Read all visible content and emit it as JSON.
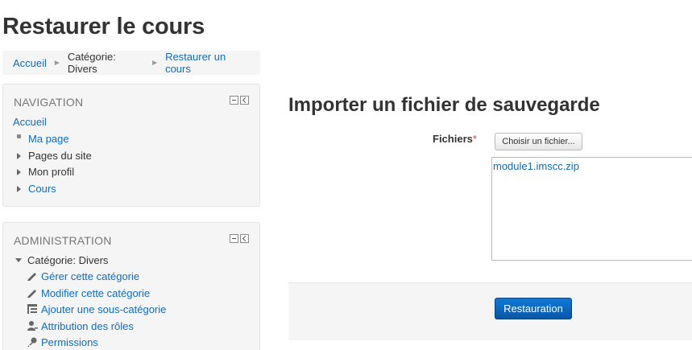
{
  "page": {
    "title": "Restaurer le cours"
  },
  "breadcrumb": {
    "items": [
      {
        "label": "Accueil"
      },
      {
        "label": "Catégorie: Divers"
      },
      {
        "label": "Restaurer un cours"
      }
    ]
  },
  "navigation": {
    "header": "NAVIGATION",
    "home": "Accueil",
    "items": [
      {
        "label": "Ma page"
      },
      {
        "label": "Pages du site"
      },
      {
        "label": "Mon profil"
      },
      {
        "label": "Cours"
      }
    ]
  },
  "administration": {
    "header": "ADMINISTRATION",
    "category": "Catégorie: Divers",
    "items": [
      {
        "label": "Gérer cette catégorie",
        "icon": "pencil-icon"
      },
      {
        "label": "Modifier cette catégorie",
        "icon": "pencil-icon"
      },
      {
        "label": "Ajouter une sous-catégorie",
        "icon": "subcategory-icon"
      },
      {
        "label": "Attribution des rôles",
        "icon": "user-role-icon"
      },
      {
        "label": "Permissions",
        "icon": "key-icon"
      }
    ]
  },
  "import": {
    "title": "Importer un fichier de sauvegarde",
    "files_label": "Fichiers",
    "required_marker": "*",
    "choose_button": "Choisir un fichier...",
    "file_name": "module1.imscc.zip",
    "restore_button": "Restauration"
  },
  "colors": {
    "link": "#0f6cbf",
    "primary_button": "#0a5dab",
    "block_bg": "#f5f5f5"
  }
}
